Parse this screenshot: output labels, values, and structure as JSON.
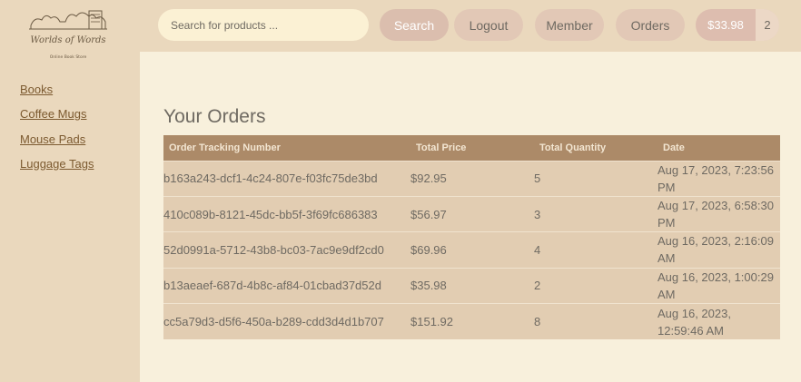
{
  "brand": {
    "logo_text": "Worlds of Words",
    "logo_tagline": "Online Book Store"
  },
  "sidebar": {
    "items": [
      {
        "label": "Books"
      },
      {
        "label": "Coffee Mugs"
      },
      {
        "label": "Mouse Pads"
      },
      {
        "label": "Luggage Tags"
      }
    ]
  },
  "header": {
    "search_placeholder": "Search for products ...",
    "search_label": "Search",
    "logout_label": "Logout",
    "member_label": "Member",
    "orders_label": "Orders",
    "cart_total": "$33.98",
    "cart_count": "2"
  },
  "main": {
    "title": "Your Orders",
    "columns": [
      "Order Tracking Number",
      "Total Price",
      "Total Quantity",
      "Date"
    ],
    "rows": [
      {
        "tracking": "b163a243-dcf1-4c24-807e-f03fc75de3bd",
        "price": "$92.95",
        "quantity": "5",
        "date": "Aug 17, 2023, 7:23:56 PM"
      },
      {
        "tracking": "410c089b-8121-45dc-bb5f-3f69fc686383",
        "price": "$56.97",
        "quantity": "3",
        "date": "Aug 17, 2023, 6:58:30 PM"
      },
      {
        "tracking": "52d0991a-5712-43b8-bc03-7ac9e9df2cd0",
        "price": "$69.96",
        "quantity": "4",
        "date": "Aug 16, 2023, 2:16:09 AM"
      },
      {
        "tracking": "b13aeaef-687d-4b8c-af84-01cbad37d52d",
        "price": "$35.98",
        "quantity": "2",
        "date": "Aug 16, 2023, 1:00:29 AM"
      },
      {
        "tracking": "cc5a79d3-d5f6-450a-b289-cdd3d4d1b707",
        "price": "$151.92",
        "quantity": "8",
        "date": "Aug 16, 2023, 12:59:46 AM"
      }
    ]
  },
  "colors": {
    "sidebar_bg": "#ead8bd",
    "page_bg": "#f8f0dc",
    "table_header_bg": "#ac8a68",
    "table_row_bg": "#e2cdb2",
    "link": "#7c5a30"
  }
}
